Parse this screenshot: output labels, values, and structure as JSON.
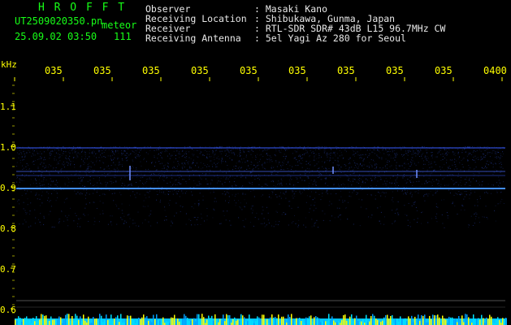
{
  "header": {
    "brand": "H R O F F T",
    "filename": "UT2509020350.pn",
    "type_tag": "meteor",
    "datetime": "25.09.02 03:50",
    "count": "111",
    "fields": [
      {
        "label": "Observer",
        "value": ": Masaki Kano"
      },
      {
        "label": "Receiving Location",
        "value": ": Shibukawa, Gunma, Japan"
      },
      {
        "label": "Receiver",
        "value": ": RTL-SDR SDR# 43dB L15 96.7MHz CW"
      },
      {
        "label": "Receiving Antenna",
        "value": ": 5el Yagi Az 280 for Seoul"
      }
    ]
  },
  "axis": {
    "unit": "kHz",
    "time_ticks": [
      "035",
      "035",
      "035",
      "035",
      "035",
      "035",
      "035",
      "035",
      "035",
      "0400"
    ],
    "freq_ticks": [
      "1.1",
      "1.0",
      "0.9",
      "0.8",
      "0.7",
      "0.6"
    ]
  },
  "colors": {
    "background": "#000000",
    "text_green": "#17ff17",
    "text_yellow": "#ffff00",
    "echo_line": "#2a7cff",
    "bottom_bar": "#00c8ff"
  }
}
